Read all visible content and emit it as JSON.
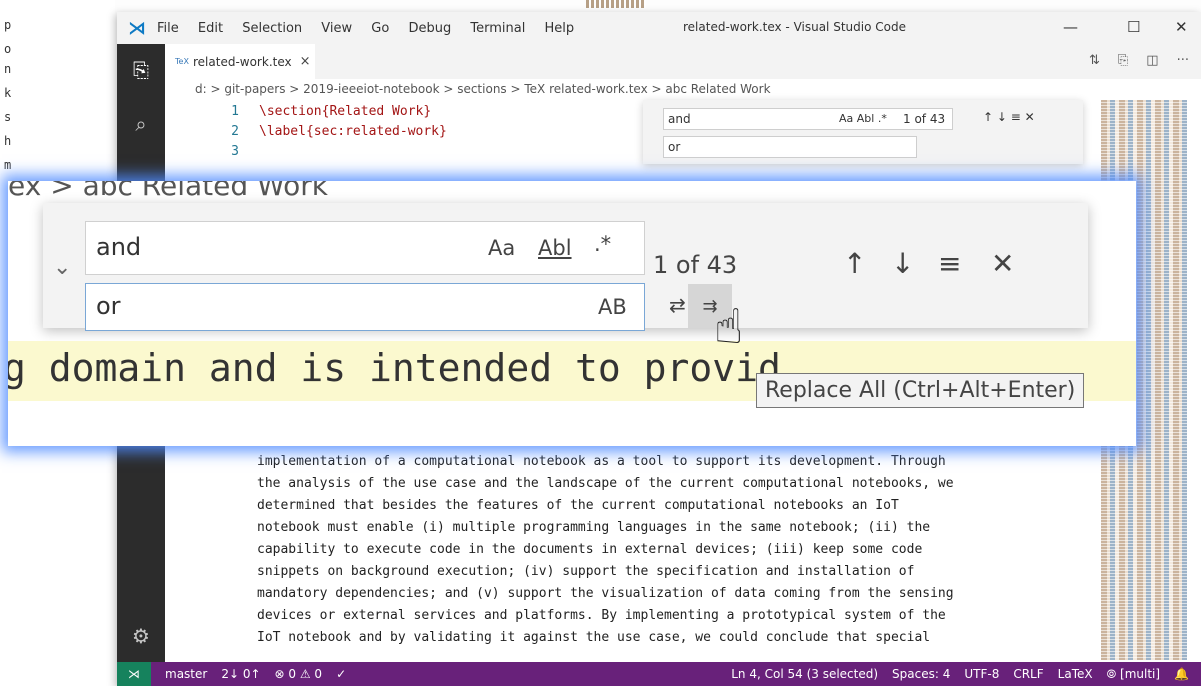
{
  "window": {
    "menu": [
      "File",
      "Edit",
      "Selection",
      "View",
      "Go",
      "Debug",
      "Terminal",
      "Help"
    ],
    "title": "related-work.tex - Visual Studio Code",
    "controls": {
      "minimize": "—",
      "maximize": "☐",
      "close": "✕"
    }
  },
  "tab": {
    "icon_text": "TeX",
    "label": "related-work.tex",
    "close": "×"
  },
  "tab_actions": [
    "⇅",
    "⎘",
    "◫",
    "···"
  ],
  "breadcrumb": "d: > git-papers > 2019-ieeeiot-notebook > sections > TeX related-work.tex > abc Related Work",
  "code_top": [
    {
      "n": "1",
      "text": "\\section{Related Work}"
    },
    {
      "n": "2",
      "text": "\\label{sec:related-work}"
    },
    {
      "n": "3",
      "text": ""
    }
  ],
  "find": {
    "search_value": "and",
    "replace_value": "or",
    "count": "1 of 43",
    "opt_case": "Aa",
    "opt_word": "Abl",
    "opt_regex": ".*",
    "opt_preserve": "AB"
  },
  "zoom": {
    "breadcrumb": "ex > abc Related Work",
    "code_line": "g domain and is intended to provid",
    "tooltip": "Replace All (Ctrl+Alt+Enter)"
  },
  "paragraph": [
    "implementation of a computational notebook as a tool to support its development. Through",
    "the analysis of the use case and the landscape of the current computational notebooks, we",
    "determined that besides the features of the current computational notebooks an IoT",
    "notebook must enable (i) multiple programming languages in the same notebook; (ii) the",
    "capability to execute code in the documents in external devices; (iii) keep some code",
    "snippets on background execution; (iv) support the specification and installation of",
    "mandatory dependencies; and (v) support the visualization of data coming from the sensing",
    "devices or external services and platforms. By implementing a prototypical system of the",
    "IoT notebook and by validating it against the use case, we could conclude that special"
  ],
  "status": {
    "branch": "master",
    "sync": "2↓ 0↑",
    "problems": "⊗ 0 ⚠ 0",
    "check": "✓",
    "position": "Ln 4, Col 54 (3 selected)",
    "spaces": "Spaces: 4",
    "encoding": "UTF-8",
    "eol": "CRLF",
    "lang": "LaTeX",
    "live": "⦾ [multi]",
    "bell": "🔔"
  },
  "colors": {
    "status_bg": "#68217a",
    "remote_bg": "#16825d",
    "match_highlight": "#f5c3a3",
    "glow": "#5a96ff"
  }
}
